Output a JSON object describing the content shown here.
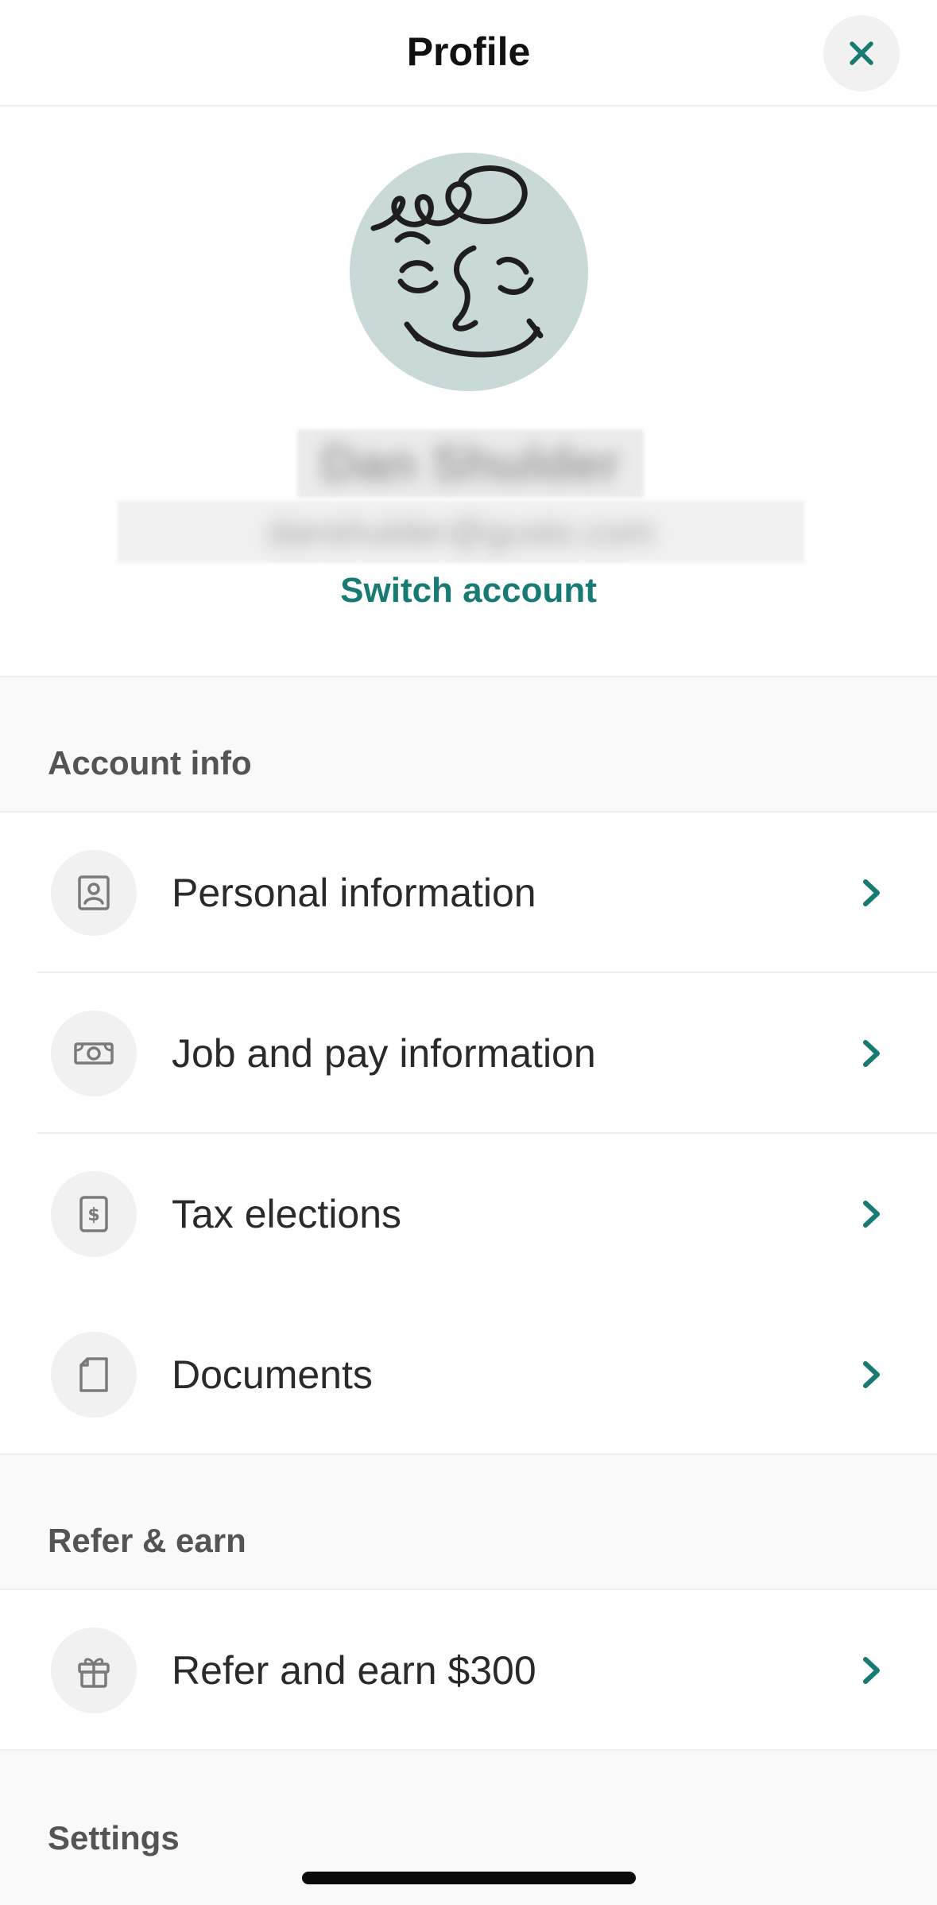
{
  "header": {
    "title": "Profile",
    "close_icon": "close-icon"
  },
  "profile": {
    "avatar_icon": "avatar-face-drawing",
    "name": "Dan Shulder",
    "email": "danshulder@gusto.com",
    "switch_account_label": "Switch account"
  },
  "sections": {
    "account_info": {
      "title": "Account info",
      "items": [
        {
          "label": "Personal information",
          "icon": "id-card-icon"
        },
        {
          "label": "Job and pay information",
          "icon": "money-icon"
        },
        {
          "label": "Tax elections",
          "icon": "tax-document-icon"
        },
        {
          "label": "Documents",
          "icon": "document-icon"
        }
      ]
    },
    "refer_earn": {
      "title": "Refer & earn",
      "items": [
        {
          "label": "Refer and earn $300",
          "icon": "gift-icon"
        }
      ]
    },
    "settings": {
      "title": "Settings"
    }
  },
  "colors": {
    "accent": "#177a73",
    "avatar_bg": "#c9d9d8",
    "section_bg": "#f9f9f9",
    "icon_bg": "#f1f1f1"
  }
}
